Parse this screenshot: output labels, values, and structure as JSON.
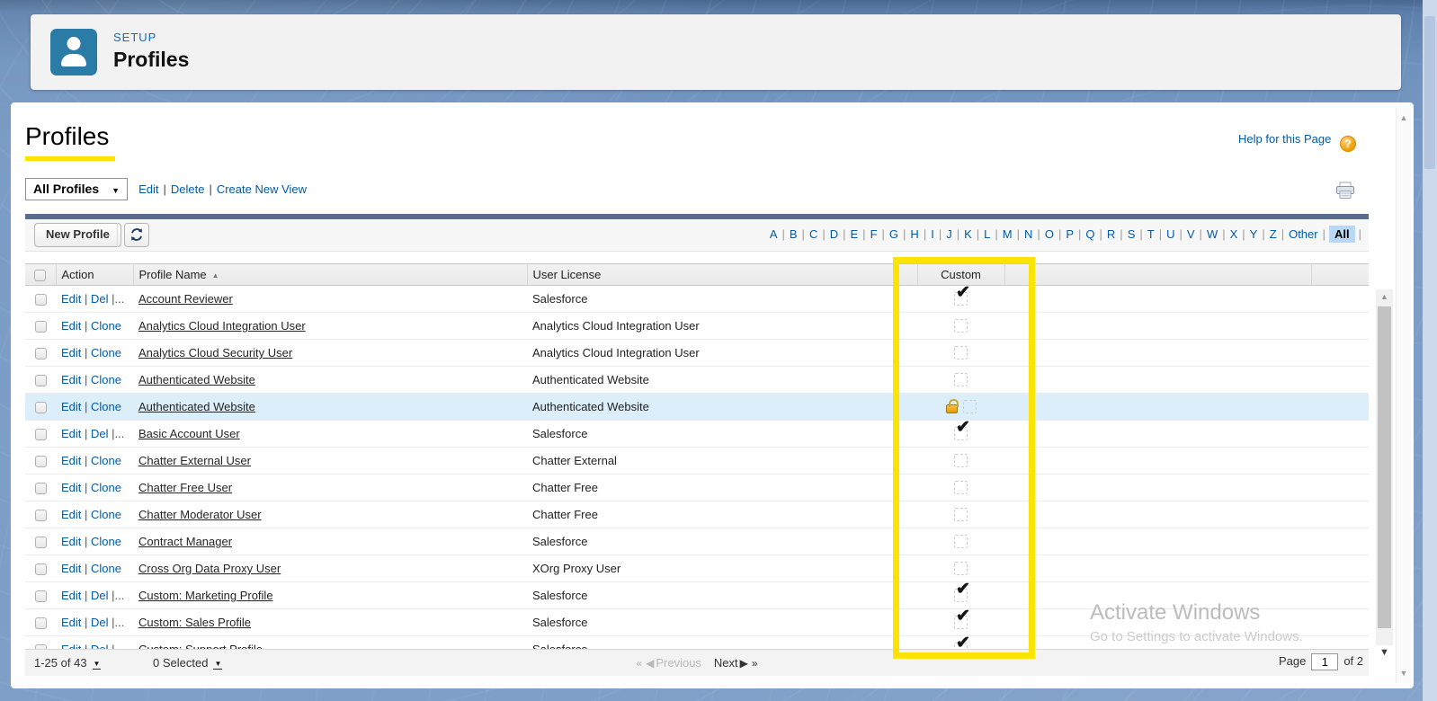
{
  "header": {
    "eyebrow": "SETUP",
    "title": "Profiles",
    "icon": "user-icon"
  },
  "page": {
    "title": "Profiles",
    "help_link": "Help for this Page",
    "view": {
      "value": "All Profiles"
    },
    "view_links": [
      "Edit",
      "Delete",
      "Create New View"
    ],
    "alphabet": [
      "A",
      "B",
      "C",
      "D",
      "E",
      "F",
      "G",
      "H",
      "I",
      "J",
      "K",
      "L",
      "M",
      "N",
      "O",
      "P",
      "Q",
      "R",
      "S",
      "T",
      "U",
      "V",
      "W",
      "X",
      "Y",
      "Z",
      "Other",
      "All"
    ],
    "alphabet_selected": "All"
  },
  "toolbar": {
    "new_profile": "New Profile",
    "refresh_icon": "refresh-icon"
  },
  "table": {
    "columns": [
      "Action",
      "Profile Name",
      "User License",
      "Custom"
    ],
    "sort_column": "Profile Name",
    "sort_direction": "ascending",
    "rows": [
      {
        "actions": [
          "Edit",
          "Del"
        ],
        "action_suffix": "|...",
        "name": "Account Reviewer",
        "license": "Salesforce",
        "custom": true,
        "locked": false,
        "highlighted": false
      },
      {
        "actions": [
          "Edit",
          "Clone"
        ],
        "action_suffix": "",
        "name": "Analytics Cloud Integration User",
        "license": "Analytics Cloud Integration User",
        "custom": false,
        "locked": false,
        "highlighted": false
      },
      {
        "actions": [
          "Edit",
          "Clone"
        ],
        "action_suffix": "",
        "name": "Analytics Cloud Security User",
        "license": "Analytics Cloud Integration User",
        "custom": false,
        "locked": false,
        "highlighted": false
      },
      {
        "actions": [
          "Edit",
          "Clone"
        ],
        "action_suffix": "",
        "name": "Authenticated Website",
        "license": "Authenticated Website",
        "custom": false,
        "locked": false,
        "highlighted": false
      },
      {
        "actions": [
          "Edit",
          "Clone"
        ],
        "action_suffix": "",
        "name": "Authenticated Website",
        "license": "Authenticated Website",
        "custom": false,
        "locked": true,
        "highlighted": true
      },
      {
        "actions": [
          "Edit",
          "Del"
        ],
        "action_suffix": "|...",
        "name": "Basic Account User",
        "license": "Salesforce",
        "custom": true,
        "locked": false,
        "highlighted": false
      },
      {
        "actions": [
          "Edit",
          "Clone"
        ],
        "action_suffix": "",
        "name": "Chatter External User",
        "license": "Chatter External",
        "custom": false,
        "locked": false,
        "highlighted": false
      },
      {
        "actions": [
          "Edit",
          "Clone"
        ],
        "action_suffix": "",
        "name": "Chatter Free User",
        "license": "Chatter Free",
        "custom": false,
        "locked": false,
        "highlighted": false
      },
      {
        "actions": [
          "Edit",
          "Clone"
        ],
        "action_suffix": "",
        "name": "Chatter Moderator User",
        "license": "Chatter Free",
        "custom": false,
        "locked": false,
        "highlighted": false
      },
      {
        "actions": [
          "Edit",
          "Clone"
        ],
        "action_suffix": "",
        "name": "Contract Manager",
        "license": "Salesforce",
        "custom": false,
        "locked": false,
        "highlighted": false
      },
      {
        "actions": [
          "Edit",
          "Clone"
        ],
        "action_suffix": "",
        "name": "Cross Org Data Proxy User",
        "license": "XOrg Proxy User",
        "custom": false,
        "locked": false,
        "highlighted": false
      },
      {
        "actions": [
          "Edit",
          "Del"
        ],
        "action_suffix": "|...",
        "name": "Custom: Marketing Profile",
        "license": "Salesforce",
        "custom": true,
        "locked": false,
        "highlighted": false
      },
      {
        "actions": [
          "Edit",
          "Del"
        ],
        "action_suffix": "|...",
        "name": "Custom: Sales Profile",
        "license": "Salesforce",
        "custom": true,
        "locked": false,
        "highlighted": false
      },
      {
        "actions": [
          "Edit",
          "Del"
        ],
        "action_suffix": "|...",
        "name": "Custom: Support Profile",
        "license": "Salesforce",
        "custom": true,
        "locked": false,
        "highlighted": false,
        "partial": true
      }
    ]
  },
  "footer": {
    "range_label": "1-25 of 43",
    "selected_label": "0 Selected",
    "prev_label": "Previous",
    "next_label": "Next",
    "page_label": "Page",
    "page_value": "1",
    "page_total": "of 2"
  },
  "watermark": {
    "line1": "Activate Windows",
    "line2": "Go to Settings to activate Windows."
  },
  "colors": {
    "link_blue": "#015ba7",
    "annotation_yellow": "#fbe305",
    "row_highlight": "#dceefa",
    "setup_icon_bg": "#2a7ba6",
    "help_icon_orange": "#ef9d00",
    "divider_bar": "#5b6d8e"
  }
}
